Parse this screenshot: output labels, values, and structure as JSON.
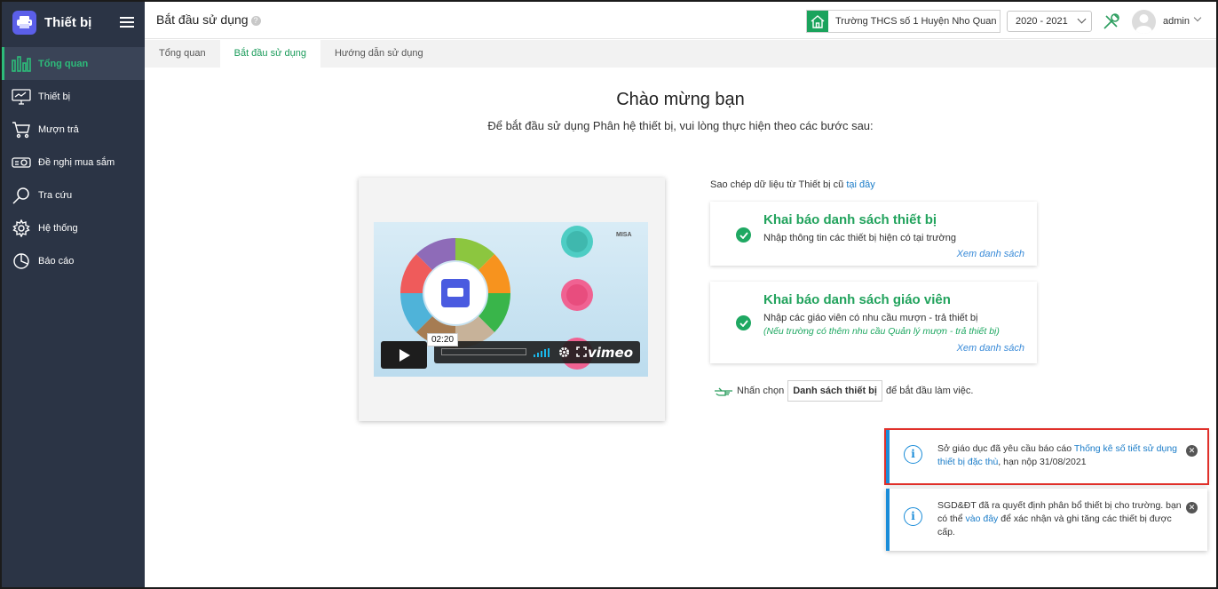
{
  "app": {
    "title": "Thiết bị"
  },
  "sidebar": {
    "items": [
      {
        "label": "Tổng quan",
        "icon": "chart-bars-icon",
        "active": true
      },
      {
        "label": "Thiết bị",
        "icon": "monitor-icon"
      },
      {
        "label": "Mượn trả",
        "icon": "cart-icon"
      },
      {
        "label": "Đề nghị mua sắm",
        "icon": "projector-icon"
      },
      {
        "label": "Tra cứu",
        "icon": "search-icon"
      },
      {
        "label": "Hệ thống",
        "icon": "gear-icon"
      },
      {
        "label": "Báo cáo",
        "icon": "pie-chart-icon"
      }
    ]
  },
  "header": {
    "page_title": "Bắt đầu sử dụng",
    "help": "?",
    "school": "Trường THCS số 1 Huyện Nho Quan",
    "year": "2020 - 2021",
    "user": "admin"
  },
  "tabs": [
    {
      "label": "Tổng quan"
    },
    {
      "label": "Bắt đầu sử dụng",
      "active": true
    },
    {
      "label": "Hướng dẫn sử dụng"
    }
  ],
  "main": {
    "welcome": "Chào mừng bạn",
    "subtitle": "Để bắt đầu sử dụng Phân hệ thiết bị, vui lòng thực hiện theo các bước sau:",
    "video": {
      "time": "02:20",
      "brand": "vimeo",
      "watermark": "MISA"
    },
    "copy_prefix": "Sao chép dữ liệu từ Thiết bị cũ",
    "copy_link": "tại đây",
    "steps": [
      {
        "title": "Khai báo danh sách thiết bị",
        "desc": "Nhập thông tin các thiết bị hiện có tại trường",
        "link": "Xem danh sách"
      },
      {
        "title": "Khai báo danh sách giáo viên",
        "desc": "Nhập các giáo viên có nhu cầu mượn - trả thiết bị",
        "note": "(Nếu trường có thêm nhu cầu Quản lý mượn - trả thiết bị)",
        "link": "Xem danh sách"
      }
    ],
    "hint": {
      "prefix": "Nhấn chọn",
      "button": "Danh sách thiết bị",
      "suffix": "để bắt đầu làm việc."
    }
  },
  "notifications": [
    {
      "text_before": "Sở giáo dục đã yêu cầu báo cáo ",
      "link": "Thống kê số tiết sử dụng thiết bị đặc thù",
      "text_after": ", hạn nộp 31/08/2021"
    },
    {
      "text_before": "SGD&ĐT đã ra quyết định phân bổ thiết bị cho trường. bạn có thể ",
      "link": "vào đây",
      "text_after": " để xác nhận và ghi tăng các thiết bị được cấp."
    }
  ],
  "colors": {
    "sidebar": "#2b3445",
    "accent": "#2dbc7a",
    "link": "#1a7cc8",
    "highlight": "#e0302a"
  }
}
